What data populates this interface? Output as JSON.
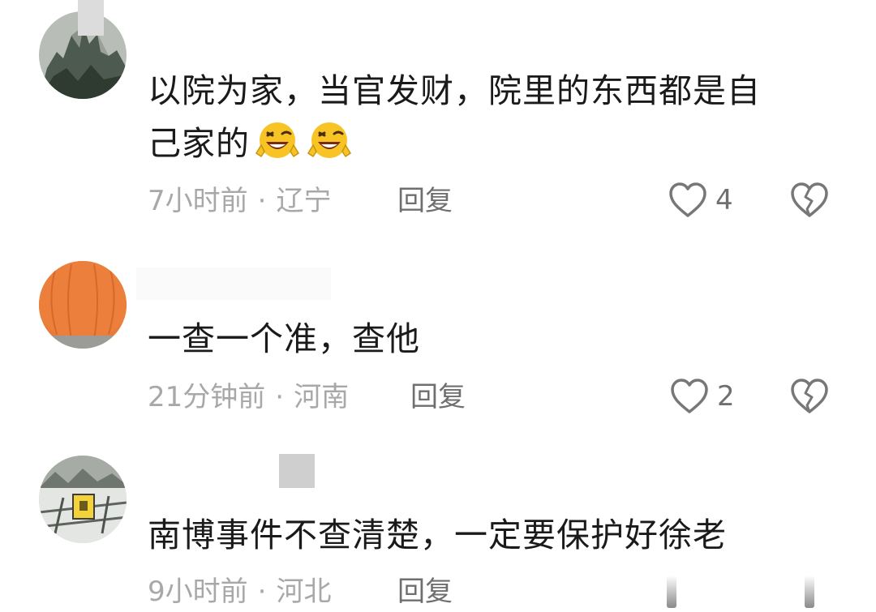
{
  "comments": [
    {
      "text_line1": "以院为家，当官发财，院里的东西都是自",
      "text_line2": "己家的",
      "emoji_name": "laughing-wink-emoji",
      "time": "7小时前",
      "dot": "·",
      "location": "辽宁",
      "reply": "回复",
      "likes": "4"
    },
    {
      "text": "一查一个准，查他",
      "time": "21分钟前",
      "dot": "·",
      "location": "河南",
      "reply": "回复",
      "likes": "2"
    },
    {
      "text": "南博事件不查清楚，一定要保护好徐老",
      "time": "9小时前",
      "dot": "·",
      "location": "河北",
      "reply": "回复"
    }
  ],
  "icons": {
    "like": "heart-outline-icon",
    "dislike": "broken-heart-icon"
  },
  "colors": {
    "text": "#1a1a1a",
    "meta": "#a8a8a8",
    "action": "#6f6f6f",
    "icon": "#777777"
  }
}
